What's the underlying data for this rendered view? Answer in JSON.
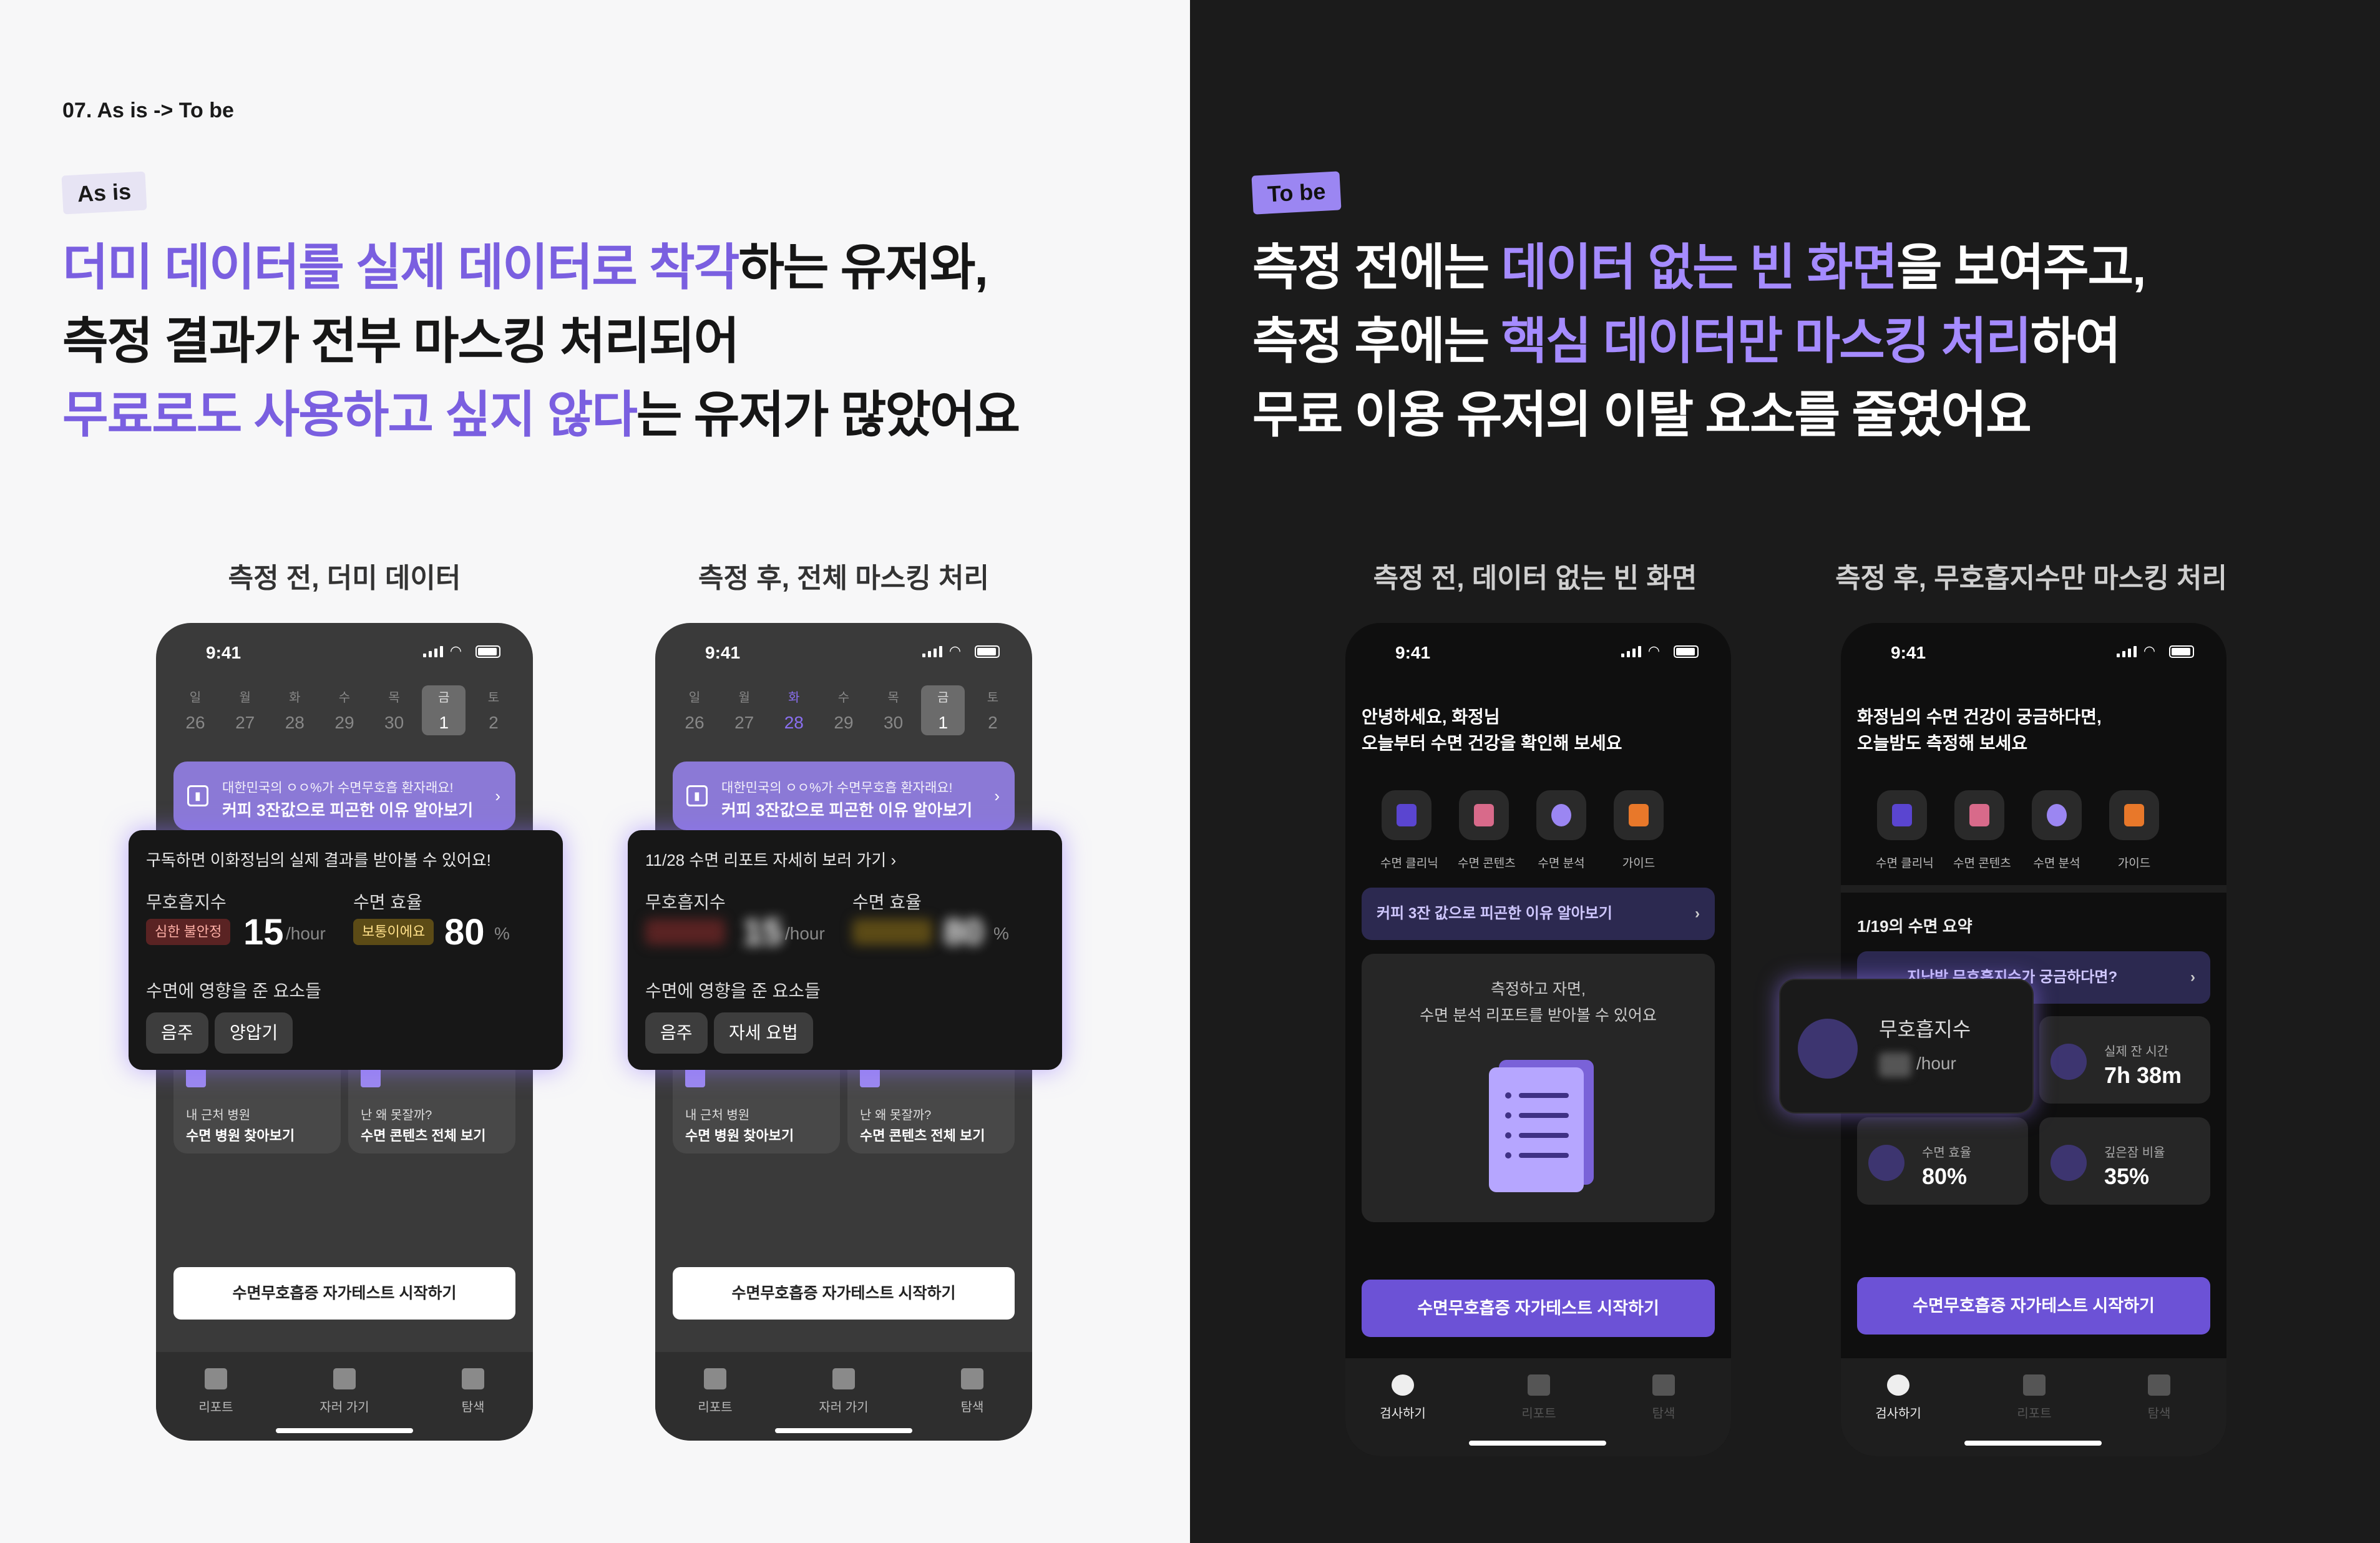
{
  "left": {
    "section_label": "07. As is -> To be",
    "tag": "As is",
    "headline": {
      "l1a": "더미 데이터를 실제 데이터로 착각",
      "l1b": "하는 유저와,",
      "l2": "측정 결과가 전부 마스킹 처리되어",
      "l3a": "무료로도 사용하고 싶지 않다",
      "l3b": "는 유저가 많았어요"
    },
    "caption1": "측정 전, 더미 데이터",
    "caption2": "측정 후, 전체 마스킹 처리"
  },
  "right": {
    "tag": "To be",
    "headline": {
      "l1a": "측정 전에는 ",
      "l1b": "데이터 없는 빈 화면",
      "l1c": "을 보여주고,",
      "l2a": "측정 후에는 ",
      "l2b": "핵심 데이터만 마스킹 처리",
      "l2c": "하여",
      "l3": "무료 이용 유저의 이탈 요소를 줄였어요"
    },
    "caption1": "측정 전, 데이터 없는 빈 화면",
    "caption2": "측정 후, 무호흡지수만 마스킹 처리"
  },
  "phone": {
    "time": "9:41",
    "week": [
      {
        "n": "일",
        "d": "26"
      },
      {
        "n": "월",
        "d": "27"
      },
      {
        "n": "화",
        "d": "28"
      },
      {
        "n": "수",
        "d": "29"
      },
      {
        "n": "목",
        "d": "30"
      },
      {
        "n": "금",
        "d": "1"
      },
      {
        "n": "토",
        "d": "2"
      }
    ],
    "banner_l1": "대한민국의 ㅇㅇ%가 수면무호흡 환자래요!",
    "banner_l2": "커피 3잔값으로 피곤한 이유 알아보기",
    "overlay1_title": "구독하면 이화정님의 실제 결과를 받아볼 수 있어요!",
    "overlay2_title": "11/28 수면 리포트 자세히 보러 가기  ›",
    "metric1_label": "무호흡지수",
    "metric2_label": "수면 효율",
    "badge_bad": "심한 불안정",
    "badge_ok": "보통이에요",
    "value1": "15",
    "unit1": "/hour",
    "value2": "80",
    "unit2": "%",
    "factors_label": "수면에 영향을 준 요소들",
    "chips1": [
      "음주",
      "양압기"
    ],
    "chips2": [
      "음주",
      "자세 요법"
    ],
    "mini1_s1": "내 근처 병원",
    "mini1_s2": "수면 병원 찾아보기",
    "mini2_s1": "난 왜 못잘까?",
    "mini2_s2": "수면 콘텐츠 전체 보기",
    "cta": "수면무호흡증 자가테스트 시작하기",
    "tabs_gray": [
      "리포트",
      "자러 가기",
      "탐색"
    ],
    "tabs_dark": [
      "검사하기",
      "리포트",
      "탐색"
    ]
  },
  "dark1": {
    "greet_l1": "안녕하세요, 화정님",
    "greet_l2": "오늘부터 수면 건강을 확인해 보세요",
    "icons": [
      "수면 클리닉",
      "수면 콘텐츠",
      "수면 분석",
      "가이드"
    ],
    "banner": "커피 3잔 값으로 피곤한 이유 알아보기",
    "empty_l1": "측정하고 자면,",
    "empty_l2": "수면 분석 리포트를 받아볼 수 있어요",
    "cta": "수면무호흡증 자가테스트 시작하기"
  },
  "dark2": {
    "greet_l1": "화정님의 수면 건강이 궁금하다면,",
    "greet_l2": "오늘밤도 측정해 보세요",
    "summary": "1/19의 수면 요약",
    "question": "지난밤 무호흡지수가 궁금하다면?",
    "pop_title": "무호흡지수",
    "pop_unit": "/hour",
    "stat1_label": "실제 잔 시간",
    "stat1_value": "7h 38m",
    "stat2_label": "수면 효율",
    "stat2_value": "80%",
    "stat3_label": "깊은잠 비율",
    "stat3_value": "35%",
    "cta": "수면무호흡증 자가테스트 시작하기"
  },
  "colors": {
    "accent": "#7a5fe0",
    "accent_dark": "#6c52d6",
    "bg_dark": "#1b1b1b"
  }
}
